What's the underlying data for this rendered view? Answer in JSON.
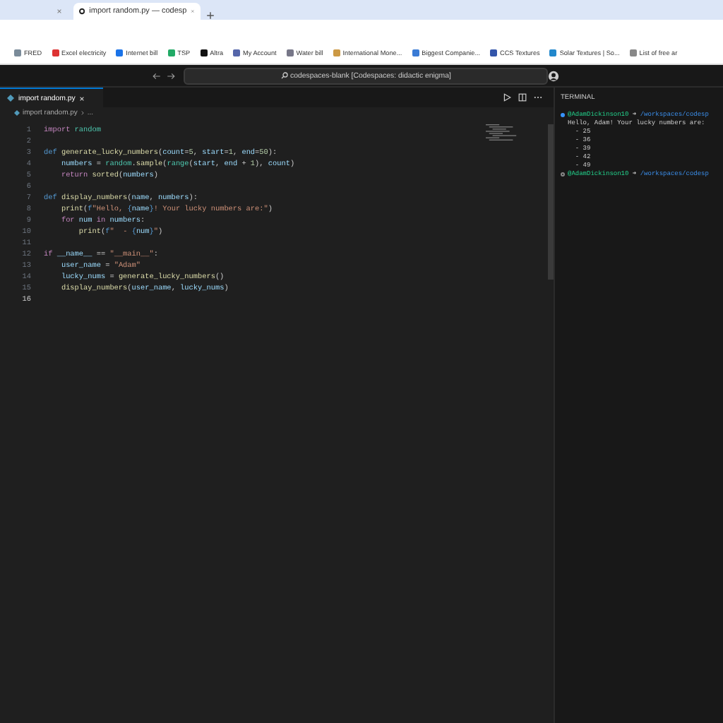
{
  "browser": {
    "tabs": [
      {
        "selected": false
      },
      {
        "title": "import random.py — codesp",
        "selected": true
      }
    ],
    "bookmarks": [
      "FRED",
      "Excel electricity",
      "Internet bill",
      "TSP",
      "Altra",
      "My Account",
      "Water bill",
      "International Mone...",
      "Biggest Companie...",
      "CCS Textures",
      "Solar Textures | So...",
      "List of free ar"
    ]
  },
  "titlebar": {
    "search": "codespaces-blank [Codespaces: didactic enigma]"
  },
  "editor": {
    "tab": {
      "label": "import random.py"
    },
    "breadcrumb": [
      "import random.py",
      "..."
    ],
    "lines": [
      {
        "number": "1",
        "current": false,
        "tokens": [
          {
            "kind": "keyword",
            "text": "import"
          },
          {
            "kind": "module",
            "text": " random"
          }
        ]
      },
      {
        "number": "2",
        "current": false
      },
      {
        "number": "3",
        "current": false,
        "tokens": [
          {
            "kind": "def",
            "text": "def"
          },
          {
            "kind": "function",
            "text": " generate_lucky_numbers"
          },
          {
            "kind": "plain",
            "text": "("
          },
          {
            "kind": "param",
            "text": "count"
          },
          {
            "kind": "plain",
            "text": "="
          },
          {
            "kind": "number",
            "text": "5"
          },
          {
            "kind": "plain",
            "text": ","
          },
          {
            "kind": "param",
            "text": " start"
          },
          {
            "kind": "plain",
            "text": "="
          },
          {
            "kind": "number",
            "text": "1"
          },
          {
            "kind": "plain",
            "text": ","
          },
          {
            "kind": "param",
            "text": " end"
          },
          {
            "kind": "plain",
            "text": "="
          },
          {
            "kind": "number",
            "text": "50"
          },
          {
            "kind": "plain",
            "text": "):"
          }
        ]
      },
      {
        "number": "4",
        "current": false,
        "tokens": [
          {
            "kind": "param",
            "text": "    numbers"
          },
          {
            "kind": "plain",
            "text": " ="
          },
          {
            "kind": "module",
            "text": " random"
          },
          {
            "kind": "plain",
            "text": "."
          },
          {
            "kind": "function",
            "text": "sample"
          },
          {
            "kind": "plain",
            "text": "("
          },
          {
            "kind": "module",
            "text": "range"
          },
          {
            "kind": "plain",
            "text": "("
          },
          {
            "kind": "param",
            "text": "start"
          },
          {
            "kind": "plain",
            "text": ","
          },
          {
            "kind": "param",
            "text": " end"
          },
          {
            "kind": "plain",
            "text": " +"
          },
          {
            "kind": "number",
            "text": " 1"
          },
          {
            "kind": "plain",
            "text": "),"
          },
          {
            "kind": "param",
            "text": " count"
          },
          {
            "kind": "plain",
            "text": ")"
          }
        ]
      },
      {
        "number": "5",
        "current": false,
        "tokens": [
          {
            "kind": "keyword",
            "text": "    return"
          },
          {
            "kind": "function",
            "text": " sorted"
          },
          {
            "kind": "plain",
            "text": "("
          },
          {
            "kind": "param",
            "text": "numbers"
          },
          {
            "kind": "plain",
            "text": ")"
          }
        ]
      },
      {
        "number": "6",
        "current": false
      },
      {
        "number": "7",
        "current": false,
        "tokens": [
          {
            "kind": "def",
            "text": "def"
          },
          {
            "kind": "function",
            "text": " display_numbers"
          },
          {
            "kind": "plain",
            "text": "("
          },
          {
            "kind": "param",
            "text": "name"
          },
          {
            "kind": "plain",
            "text": ","
          },
          {
            "kind": "param",
            "text": " numbers"
          },
          {
            "kind": "plain",
            "text": "):"
          }
        ]
      },
      {
        "number": "8",
        "current": false,
        "tokens": [
          {
            "kind": "function",
            "text": "    print"
          },
          {
            "kind": "plain",
            "text": "("
          },
          {
            "kind": "def",
            "text": "f"
          },
          {
            "kind": "string",
            "text": "\"Hello, "
          },
          {
            "kind": "def",
            "text": "{"
          },
          {
            "kind": "param",
            "text": "name"
          },
          {
            "kind": "def",
            "text": "}"
          },
          {
            "kind": "string",
            "text": "! Your lucky numbers are:\""
          },
          {
            "kind": "plain",
            "text": ")"
          }
        ]
      },
      {
        "number": "9",
        "current": false,
        "tokens": [
          {
            "kind": "keyword",
            "text": "    for"
          },
          {
            "kind": "param",
            "text": " num"
          },
          {
            "kind": "keyword",
            "text": " in"
          },
          {
            "kind": "param",
            "text": " numbers"
          },
          {
            "kind": "plain",
            "text": ":"
          }
        ]
      },
      {
        "number": "10",
        "current": false,
        "tokens": [
          {
            "kind": "function",
            "text": "        print"
          },
          {
            "kind": "plain",
            "text": "("
          },
          {
            "kind": "def",
            "text": "f"
          },
          {
            "kind": "string",
            "text": "\"  - "
          },
          {
            "kind": "def",
            "text": "{"
          },
          {
            "kind": "param",
            "text": "num"
          },
          {
            "kind": "def",
            "text": "}"
          },
          {
            "kind": "string",
            "text": "\""
          },
          {
            "kind": "plain",
            "text": ")"
          }
        ]
      },
      {
        "number": "11",
        "current": false
      },
      {
        "number": "12",
        "current": false,
        "tokens": [
          {
            "kind": "keyword",
            "text": "if"
          },
          {
            "kind": "param",
            "text": " __name__"
          },
          {
            "kind": "plain",
            "text": " =="
          },
          {
            "kind": "string",
            "text": " \"__main__\""
          },
          {
            "kind": "plain",
            "text": ":"
          }
        ]
      },
      {
        "number": "13",
        "current": false,
        "tokens": [
          {
            "kind": "param",
            "text": "    user_name"
          },
          {
            "kind": "plain",
            "text": " ="
          },
          {
            "kind": "string",
            "text": " \"Adam\""
          }
        ]
      },
      {
        "number": "14",
        "current": false,
        "tokens": [
          {
            "kind": "param",
            "text": "    lucky_nums"
          },
          {
            "kind": "plain",
            "text": " ="
          },
          {
            "kind": "function",
            "text": " generate_lucky_numbers"
          },
          {
            "kind": "plain",
            "text": "()"
          }
        ]
      },
      {
        "number": "15",
        "current": false,
        "tokens": [
          {
            "kind": "function",
            "text": "    display_numbers"
          },
          {
            "kind": "plain",
            "text": "("
          },
          {
            "kind": "param",
            "text": "user_name"
          },
          {
            "kind": "plain",
            "text": ","
          },
          {
            "kind": "param",
            "text": " lucky_nums"
          },
          {
            "kind": "plain",
            "text": ")"
          }
        ]
      },
      {
        "number": "16",
        "current": true
      }
    ]
  },
  "terminal": {
    "title": "TERMINAL",
    "lines": [
      {
        "kind": "prompt",
        "success": true,
        "user": "@AdamDickinson10",
        "arrow": "➜",
        "path": "/workspaces/codesp"
      },
      {
        "kind": "output",
        "text": "Hello, Adam! Your lucky numbers are:"
      },
      {
        "kind": "output",
        "text": "  - 25"
      },
      {
        "kind": "output",
        "text": "  - 36"
      },
      {
        "kind": "output",
        "text": "  - 39"
      },
      {
        "kind": "output",
        "text": "  - 42"
      },
      {
        "kind": "output",
        "text": "  - 49"
      },
      {
        "kind": "prompt",
        "success": false,
        "user": "@AdamDickinson10",
        "arrow": "➜",
        "path": "/workspaces/codesp"
      }
    ]
  }
}
